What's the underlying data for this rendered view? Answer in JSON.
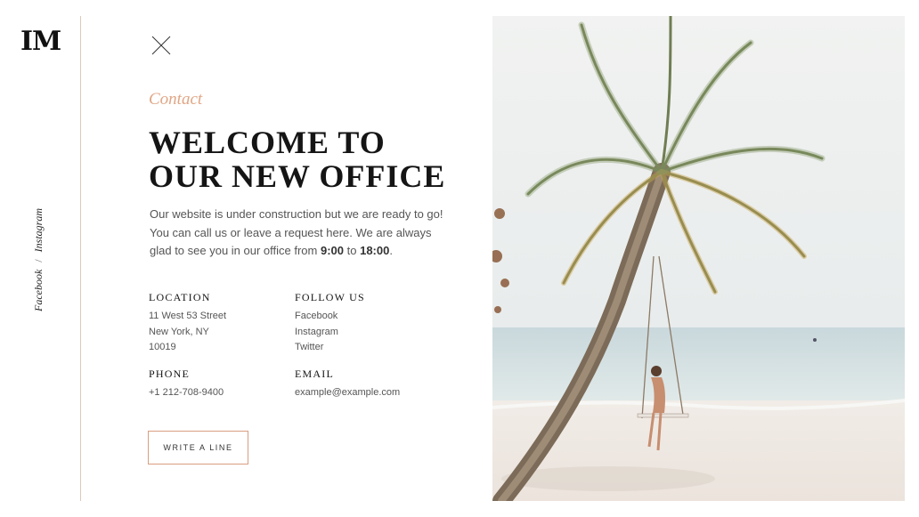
{
  "brand": {
    "logo": "IM"
  },
  "social": {
    "links": [
      "Facebook",
      "Instagram"
    ],
    "separator": "/"
  },
  "contact": {
    "kicker": "Contact",
    "headline_line1": "WELCOME TO",
    "headline_line2": "OUR NEW OFFICE",
    "intro_text": "Our website is under construction but we are ready to go! You can call us or leave a request here. We are always glad to see you in our office from ",
    "hours_from": "9:00",
    "hours_to_word": " to ",
    "hours_to": "18:00",
    "hours_end": "."
  },
  "location": {
    "heading": "LOCATION",
    "lines": [
      "11 West 53 Street",
      "New York, NY",
      "10019"
    ]
  },
  "follow": {
    "heading": "FOLLOW US",
    "links": [
      "Facebook",
      "Instagram",
      "Twitter"
    ]
  },
  "phone": {
    "heading": "PHONE",
    "value": "+1 212-708-9400"
  },
  "email": {
    "heading": "EMAIL",
    "value": "example@example.com"
  },
  "cta": {
    "label": "WRITE A LINE"
  },
  "colors": {
    "accent": "#e0a685",
    "button_border": "#d99e80",
    "rail_line": "#dcc8bc",
    "heading": "#151515"
  },
  "icons": {
    "close": "close-icon"
  }
}
